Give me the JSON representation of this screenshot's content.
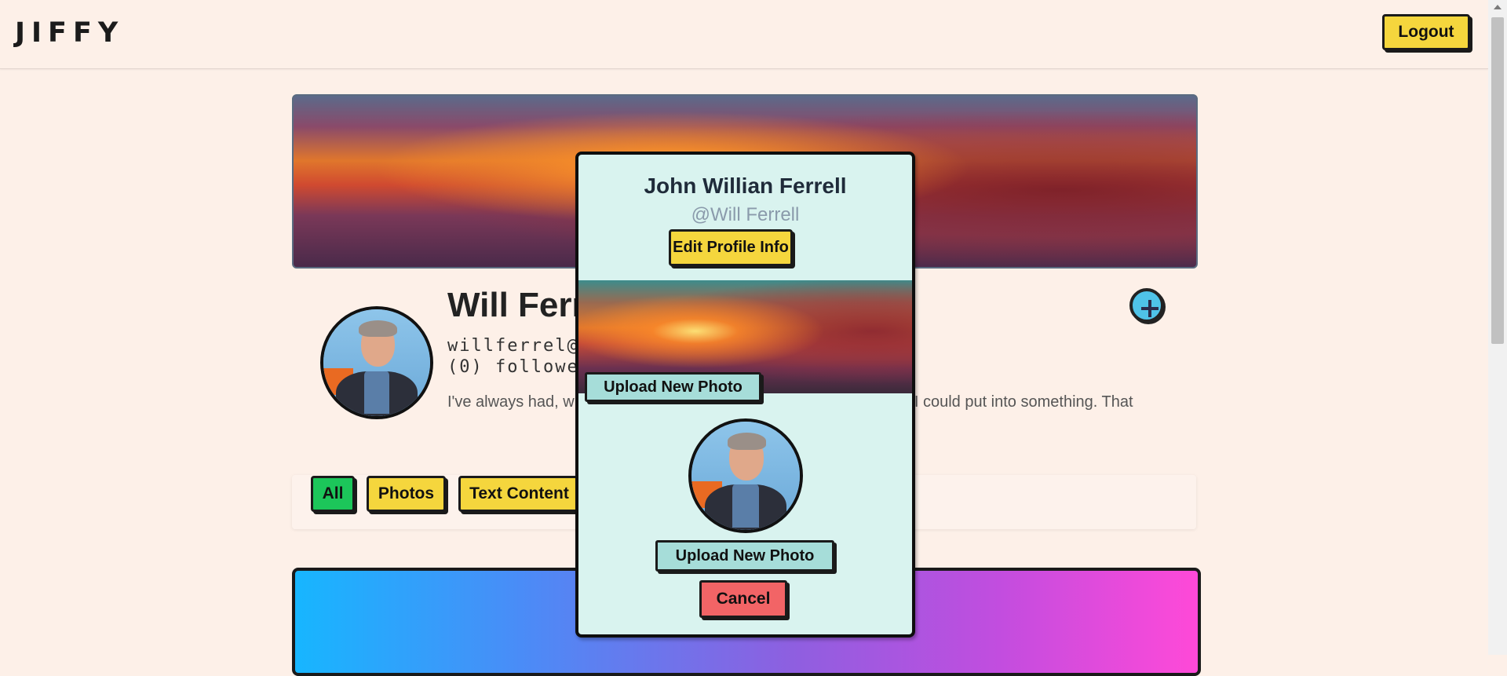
{
  "header": {
    "logo": "JIFFY",
    "logout_label": "Logout"
  },
  "profile": {
    "name": "Will Ferrell",
    "email": "willferrel@gmail.com",
    "followers": "(0) followers",
    "bio": "I've always had, whether it was in sports or in comedy, a focus that I could put into something. That",
    "add_icon": "plus-icon"
  },
  "filters": {
    "all": "All",
    "photos": "Photos",
    "text_content": "Text Content"
  },
  "modal": {
    "full_name": "John Willian Ferrell",
    "handle": "@Will Ferrell",
    "edit_label": "Edit Profile Info",
    "upload_banner_label": "Upload New Photo",
    "upload_avatar_label": "Upload New Photo",
    "cancel_label": "Cancel"
  },
  "colors": {
    "background": "#fdf0e8",
    "accent_yellow": "#f5d63d",
    "accent_green": "#1cc65a",
    "modal_bg": "#d9f3ef",
    "teal_button": "#a6ddd9",
    "cancel_red": "#f26466",
    "add_button": "#4fc3e8"
  }
}
